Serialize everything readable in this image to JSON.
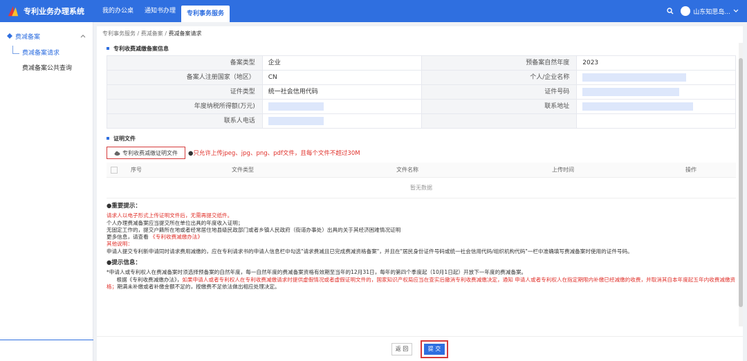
{
  "app": {
    "title": "专利业务办理系统"
  },
  "nav": {
    "items": [
      "我的办公桌",
      "通知书办理",
      "专利事务服务"
    ]
  },
  "user": {
    "name": "山东知思岛..."
  },
  "sidebar": {
    "group": "费减备案",
    "items": [
      {
        "label": "费减备案请求"
      },
      {
        "label": "费减备案公共查询"
      }
    ]
  },
  "breadcrumb": [
    "专利事务服务",
    "费减备案",
    "费减备案请求"
  ],
  "section1": {
    "title": "专利收费减缴备案信息",
    "rows": [
      {
        "l1": "备案类型",
        "v1": "企业",
        "l2": "预备案自然年度",
        "v2": "2023"
      },
      {
        "l1": "备案人注册国家（地区）",
        "v1": "CN",
        "l2": "个人/企业名称",
        "v2": ""
      },
      {
        "l1": "证件类型",
        "v1": "统一社会信用代码",
        "l2": "证件号码",
        "v2": ""
      },
      {
        "l1": "年度纳税所得额(万元)",
        "v1": "",
        "l2": "联系地址",
        "v2": ""
      },
      {
        "l1": "联系人电话",
        "v1": "",
        "l2": "",
        "v2": ""
      }
    ]
  },
  "section2": {
    "title": "证明文件",
    "upload_label": "专利收费减缴证明文件",
    "hint": "只允许上传jpeg、jpg、png、pdf文件，且每个文件不超过30M",
    "columns": [
      "序号",
      "文件类型",
      "文件名称",
      "上传时间",
      "操作"
    ],
    "empty": "暂无数据"
  },
  "notes": {
    "important_title": "重要提示：",
    "line1": "请求人以电子形式上传证明文件后，无需再提交纸件。",
    "line2": "个人办理费减备案应当提交所在单位出具的年度收入证明；",
    "line3": "无固定工作的，提交户籍所在地或者经常居住地县级民政部门或者乡镇人民政府（街道办事处）出具的关于其经济困难情况证明",
    "line4a": "更多信息，请查看",
    "line4b": "《专利收费减缴办法》",
    "line5": "其他说明：",
    "line6": "申请人提交专利新申请同时请求费用减缴的，应在专利请求书的申请人信息栏中勾选\"请求费减且已完成费减资格备案\"，并且在\"居民身份证件号码或统一社会信用代码/组织机构代码\"一栏中准确填写费减备案时使用的证件号码。",
    "tip_title": "提示信息：",
    "tip1a": "*申请人或专利权人在费减备案时须选择预备案的自然年度，每一自然年度的费减备案资格有效期至当年的12月31日，每年的第四个季度起（10月1日起）开放下一年度的费减备案。",
    "tip2a": "根据《专利收费减缴办法》，",
    "tip2b": "如果申请人或者专利权人在专利收费减缴请求时提供虚假情况或者虚假证明文件的，国家知识产权局应当在查实后撤消专利收费减缴决定，通知 申请人或者专利权人在指定期限内补缴已经减缴的收费，并取消其自本年度起五年内收费减缴资格；",
    "tip2c": "期满未补缴或者补缴金额不足的，按缴费不足依法做出相应处理决定。"
  },
  "footer": {
    "back": "返 回",
    "submit": "提 交"
  },
  "colors": {
    "primary": "#2f6fe0",
    "danger": "#e0302a"
  }
}
